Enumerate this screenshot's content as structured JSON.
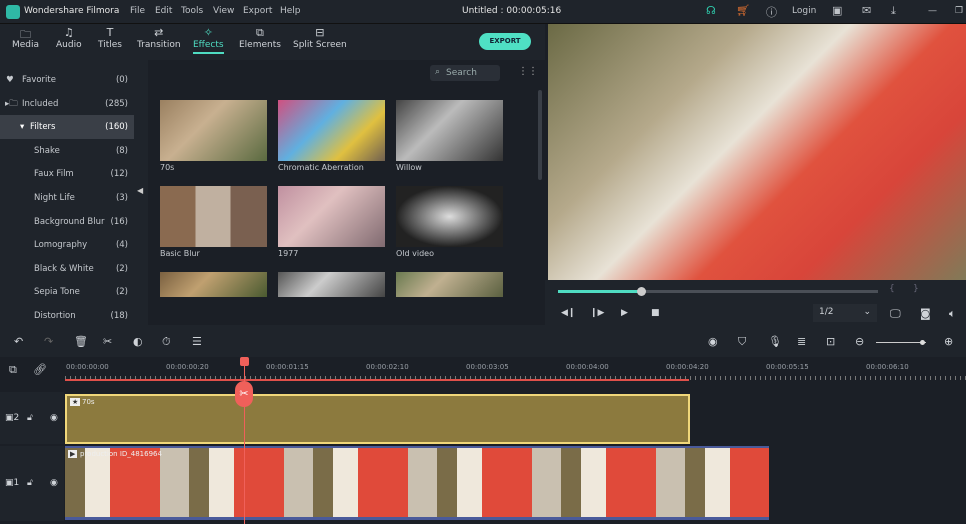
{
  "app": {
    "title": "Wondershare Filmora",
    "project": "Untitled : 00:00:05:16",
    "menu": [
      "File",
      "Edit",
      "Tools",
      "View",
      "Export",
      "Help"
    ],
    "login": "Login"
  },
  "toolbar": {
    "tabs": [
      {
        "label": "Media",
        "icon": "folder-icon"
      },
      {
        "label": "Audio",
        "icon": "music-icon"
      },
      {
        "label": "Titles",
        "icon": "text-icon"
      },
      {
        "label": "Transition",
        "icon": "transition-icon"
      },
      {
        "label": "Effects",
        "icon": "effects-icon",
        "active": true
      },
      {
        "label": "Elements",
        "icon": "elements-icon"
      },
      {
        "label": "Split Screen",
        "icon": "split-screen-icon"
      }
    ],
    "export": "EXPORT"
  },
  "sidebar": {
    "items": [
      {
        "label": "Favorite",
        "count": "(0)"
      },
      {
        "label": "Included",
        "count": "(285)"
      },
      {
        "label": "Filters",
        "count": "(160)",
        "selected": true
      },
      {
        "label": "Shake",
        "count": "(8)"
      },
      {
        "label": "Faux Film",
        "count": "(12)"
      },
      {
        "label": "Night Life",
        "count": "(3)"
      },
      {
        "label": "Background Blur",
        "count": "(16)"
      },
      {
        "label": "Lomography",
        "count": "(4)"
      },
      {
        "label": "Black & White",
        "count": "(2)"
      },
      {
        "label": "Sepia Tone",
        "count": "(2)"
      },
      {
        "label": "Distortion",
        "count": "(18)"
      }
    ]
  },
  "library": {
    "search_placeholder": "Search",
    "effects": [
      "70s",
      "Chromatic Aberration",
      "Willow",
      "Basic Blur",
      "1977",
      "Old video",
      "",
      "",
      ""
    ]
  },
  "player": {
    "progress_percent": 26,
    "quality": "1/2"
  },
  "timeline": {
    "ticks": [
      "00:00:00:00",
      "00:00:00:20",
      "00:00:01:15",
      "00:00:02:10",
      "00:00:03:05",
      "00:00:04:00",
      "00:00:04:20",
      "00:00:05:15",
      "00:00:06:10"
    ],
    "effect_clip": "70s",
    "video_clip": "production ID_4816964",
    "track2": "2",
    "track1": "1"
  },
  "colors": {
    "accent": "#4fdcc2",
    "playhead": "#f0605a",
    "effect_clip": "#8c7a3e"
  }
}
